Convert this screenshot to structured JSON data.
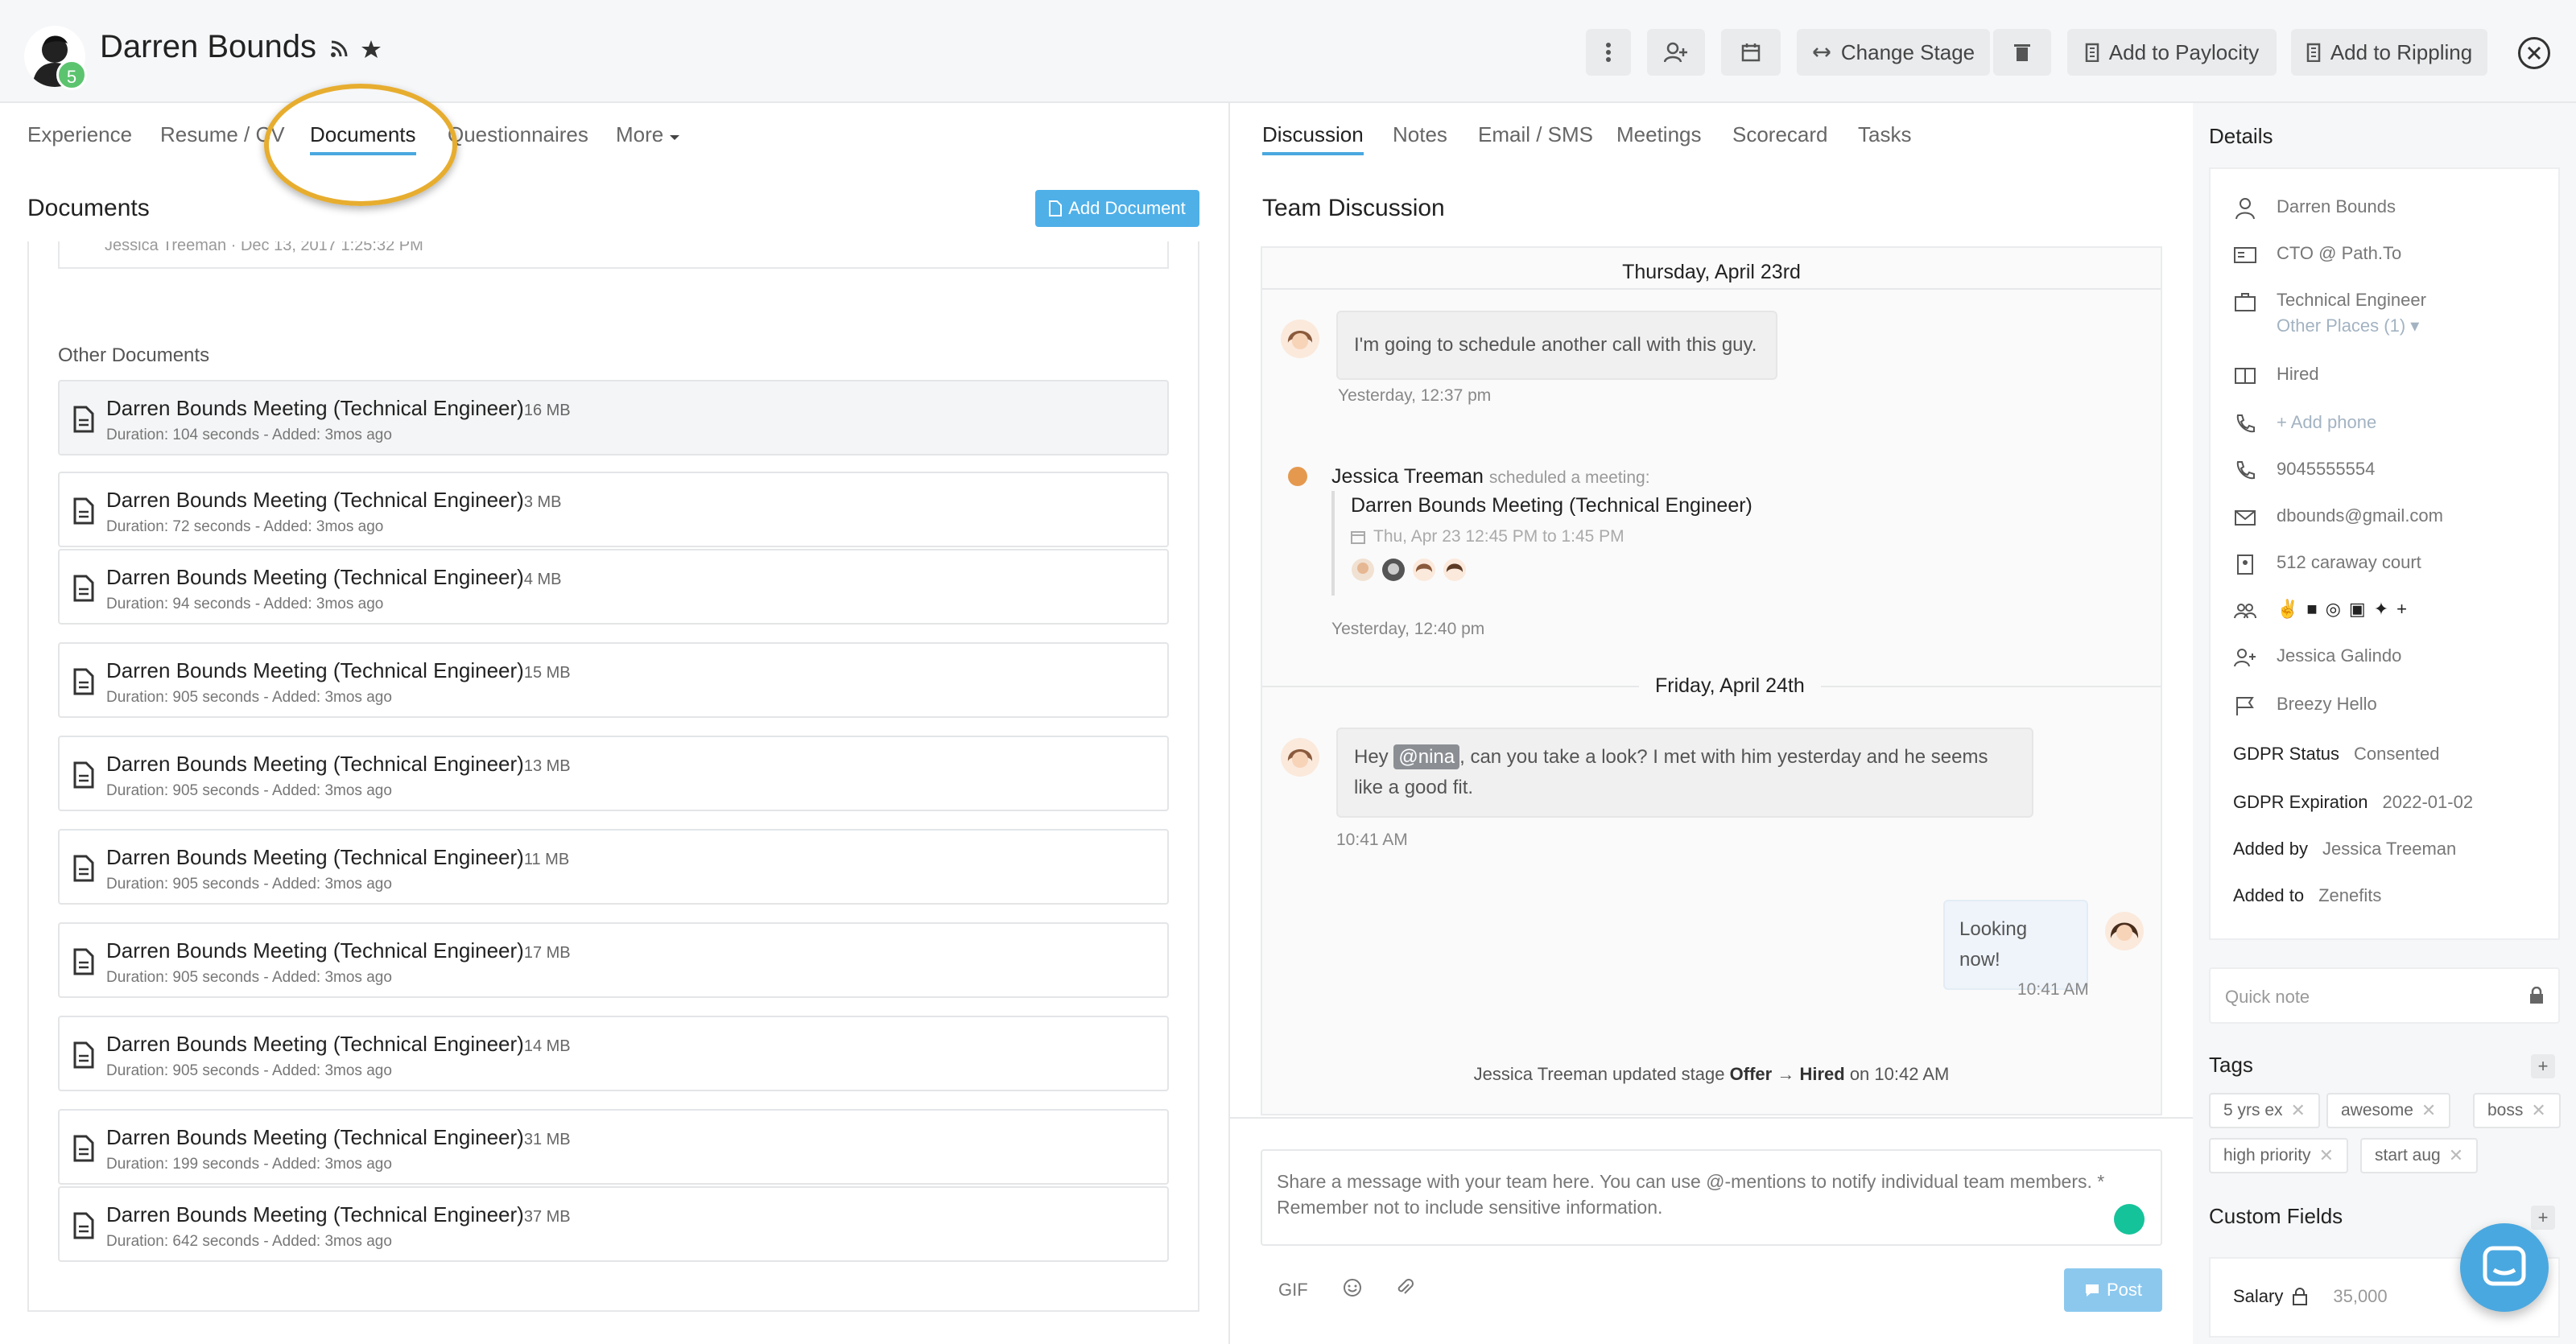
{
  "header": {
    "candidate_name": "Darren Bounds",
    "avatar_badge": "5",
    "buttons": {
      "change_stage": "Change Stage",
      "add_to_paylocity": "Add to Paylocity",
      "add_to_rippling": "Add to Rippling"
    }
  },
  "left_tabs": [
    "Experience",
    "Resume / CV",
    "Documents",
    "Questionnaires",
    "More"
  ],
  "right_tabs": [
    "Discussion",
    "Notes",
    "Email / SMS",
    "Meetings",
    "Scorecard",
    "Tasks"
  ],
  "documents": {
    "title": "Documents",
    "add_label": "Add Document",
    "prev_meta": "Jessica Treeman · Dec 13, 2017 1:25:32 PM",
    "other_label": "Other Documents",
    "items": [
      {
        "title": "Darren Bounds Meeting (Technical Engineer)",
        "size": "16 MB",
        "meta": "Duration: 104 seconds - Added: 3mos ago"
      },
      {
        "title": "Darren Bounds Meeting (Technical Engineer)",
        "size": "3 MB",
        "meta": "Duration: 72 seconds - Added: 3mos ago"
      },
      {
        "title": "Darren Bounds Meeting (Technical Engineer)",
        "size": "4 MB",
        "meta": "Duration: 94 seconds - Added: 3mos ago"
      },
      {
        "title": "Darren Bounds Meeting (Technical Engineer)",
        "size": "15 MB",
        "meta": "Duration: 905 seconds - Added: 3mos ago"
      },
      {
        "title": "Darren Bounds Meeting (Technical Engineer)",
        "size": "13 MB",
        "meta": "Duration: 905 seconds - Added: 3mos ago"
      },
      {
        "title": "Darren Bounds Meeting (Technical Engineer)",
        "size": "11 MB",
        "meta": "Duration: 905 seconds - Added: 3mos ago"
      },
      {
        "title": "Darren Bounds Meeting (Technical Engineer)",
        "size": "17 MB",
        "meta": "Duration: 905 seconds - Added: 3mos ago"
      },
      {
        "title": "Darren Bounds Meeting (Technical Engineer)",
        "size": "14 MB",
        "meta": "Duration: 905 seconds - Added: 3mos ago"
      },
      {
        "title": "Darren Bounds Meeting (Technical Engineer)",
        "size": "31 MB",
        "meta": "Duration: 199 seconds - Added: 3mos ago"
      },
      {
        "title": "Darren Bounds Meeting (Technical Engineer)",
        "size": "37 MB",
        "meta": "Duration: 642 seconds - Added: 3mos ago"
      }
    ]
  },
  "discussion": {
    "title": "Team Discussion",
    "date1": "Thursday, April 23rd",
    "msg1": "I'm going to schedule another call with this guy.",
    "msg1_time": "Yesterday, 12:37 pm",
    "meeting_author": "Jessica Treeman",
    "meeting_action": "scheduled a meeting:",
    "meeting_title": "Darren Bounds Meeting (Technical Engineer)",
    "meeting_when": "Thu, Apr 23 12:45 PM to 1:45 PM",
    "meeting_time": "Yesterday, 12:40 pm",
    "date2": "Friday, April 24th",
    "msg2_pre": "Hey",
    "msg2_mention": "@nina",
    "msg2_post": ", can you take a look? I met with him yesterday and he seems like a good fit.",
    "msg2_time": "10:41 AM",
    "msg3": "Looking now!",
    "msg3_time": "10:41 AM",
    "stage_author": "Jessica Treeman updated stage",
    "stage_from": "Offer",
    "stage_to": "Hired",
    "stage_when": "on 10:42 AM",
    "composer_placeholder": "Share a message with your team here. You can use @-mentions to notify individual team members. * Remember not to include sensitive information.",
    "gif_label": "GIF",
    "post_label": "Post"
  },
  "details": {
    "title": "Details",
    "name": "Darren Bounds",
    "position": "CTO @ Path.To",
    "job": "Technical Engineer",
    "other_places": "Other Places (1)",
    "stage": "Hired",
    "add_phone": "+ Add phone",
    "phone": "9045555554",
    "email": "dbounds@gmail.com",
    "address": "512 caraway court",
    "owner": "Jessica Galindo",
    "source": "Breezy Hello",
    "gdpr_status_label": "GDPR Status",
    "gdpr_status": "Consented",
    "gdpr_exp_label": "GDPR Expiration",
    "gdpr_exp": "2022-01-02",
    "added_by_label": "Added by",
    "added_by": "Jessica Treeman",
    "added_to_label": "Added to",
    "added_to": "Zenefits",
    "quick_note": "Quick note",
    "tags_title": "Tags",
    "tags": [
      "5 yrs ex",
      "awesome",
      "boss",
      "high priority",
      "start aug"
    ],
    "custom_fields_title": "Custom Fields",
    "salary_label": "Salary",
    "salary": "35,000"
  },
  "colors": {
    "accent": "#4aa8e0",
    "highlight": "#e7ad2f",
    "badge": "#5cc46f"
  }
}
